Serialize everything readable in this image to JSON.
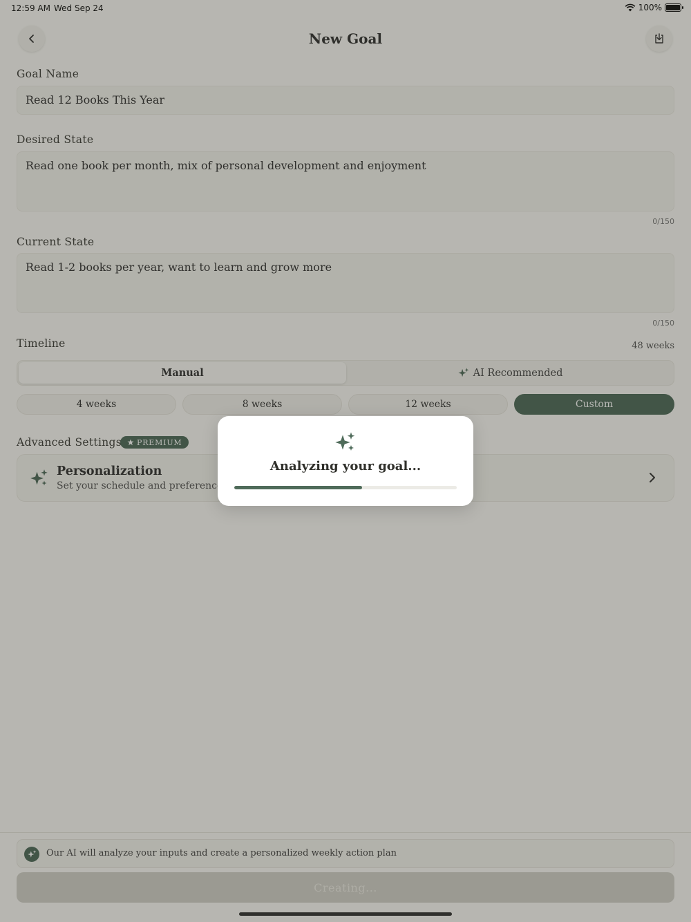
{
  "status_bar": {
    "time": "12:59 AM",
    "date": "Wed Sep 24",
    "battery": "100%"
  },
  "header": {
    "title": "New Goal"
  },
  "form": {
    "goal_name": {
      "label": "Goal Name",
      "value": "Read 12 Books This Year"
    },
    "desired_state": {
      "label": "Desired State",
      "value": "Read one book per month, mix of personal development and enjoyment",
      "counter": "0/150"
    },
    "current_state": {
      "label": "Current State",
      "value": "Read 1-2 books per year, want to learn and grow more",
      "counter": "0/150"
    },
    "timeline": {
      "label": "Timeline",
      "value": "48 weeks",
      "modes": [
        "Manual",
        "AI Recommended"
      ],
      "selected_mode": "Manual",
      "options": [
        "4 weeks",
        "8 weeks",
        "12 weeks",
        "Custom"
      ],
      "selected_option": "Custom"
    },
    "advanced": {
      "label": "Advanced Settings",
      "badge": "PREMIUM",
      "card_title": "Personalization",
      "card_subtitle": "Set your schedule and preferences"
    }
  },
  "footer": {
    "info_text": "Our AI will analyze your inputs and create a personalized weekly action plan",
    "button_label": "Creating..."
  },
  "modal": {
    "title": "Analyzing your goal...",
    "progress": 0.575
  },
  "colors": {
    "accent": "#4f6b5a",
    "background": "#fbfaf6"
  },
  "icons": [
    "chevron-left-icon",
    "download-icon",
    "sparkles-icon",
    "star-icon",
    "chevron-right-icon",
    "wifi-icon",
    "battery-icon"
  ]
}
